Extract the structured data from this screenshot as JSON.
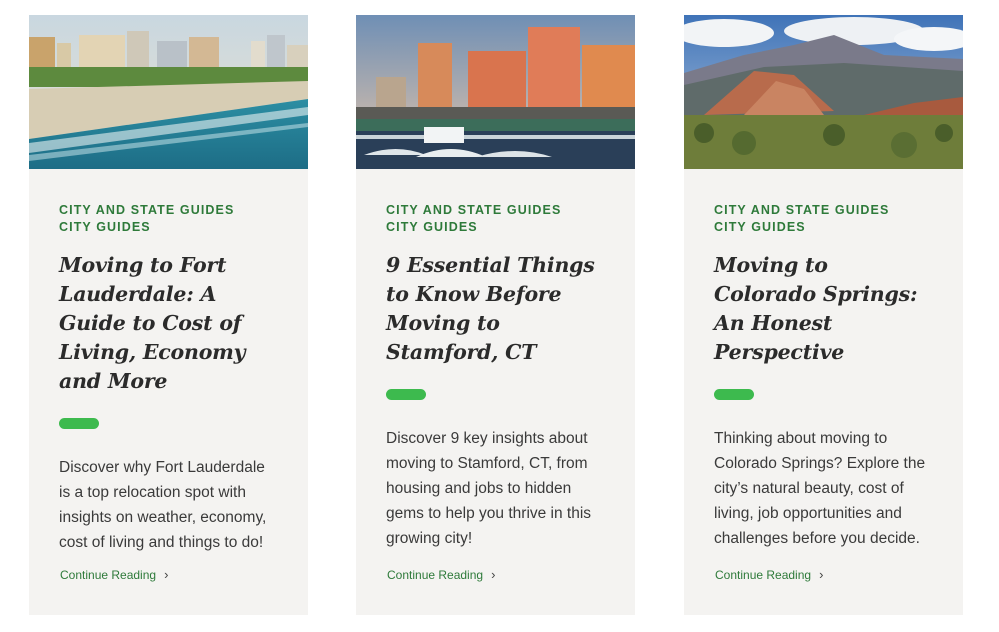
{
  "cards": [
    {
      "categories": [
        "CITY AND STATE GUIDES",
        "CITY GUIDES"
      ],
      "title": "Moving to Fort Lauderdale: A Guide to Cost of Living, Economy and More",
      "excerpt": "Discover why Fort Lauderdale is a top relocation spot with insights on weather, economy, cost of living and things to do!",
      "link": "Continue Reading",
      "image": "beach-skyline-image"
    },
    {
      "categories": [
        "CITY AND STATE GUIDES",
        "CITY GUIDES"
      ],
      "title": "9 Essential Things to Know Before Moving to Stamford, CT",
      "excerpt": "Discover 9 key insights about moving to Stamford, CT, from housing and jobs to hidden gems to help you thrive in this growing city!",
      "link": "Continue Reading",
      "image": "marina-skyline-image"
    },
    {
      "categories": [
        "CITY AND STATE GUIDES",
        "CITY GUIDES"
      ],
      "title": "Moving to Colorado Springs: An Honest Perspective",
      "excerpt": "Thinking about moving to Colorado Springs? Explore the city’s natural beauty, cost of living, job opportunities and challenges before you decide.",
      "link": "Continue Reading",
      "image": "mountain-rocks-image"
    }
  ],
  "colors": {
    "accent": "#2e7a3a",
    "pill": "#3dba4e",
    "card_bg": "#f4f3f1",
    "text": "#2b2b2b"
  },
  "icons": {
    "link_chevron": "chevron-right-icon"
  }
}
